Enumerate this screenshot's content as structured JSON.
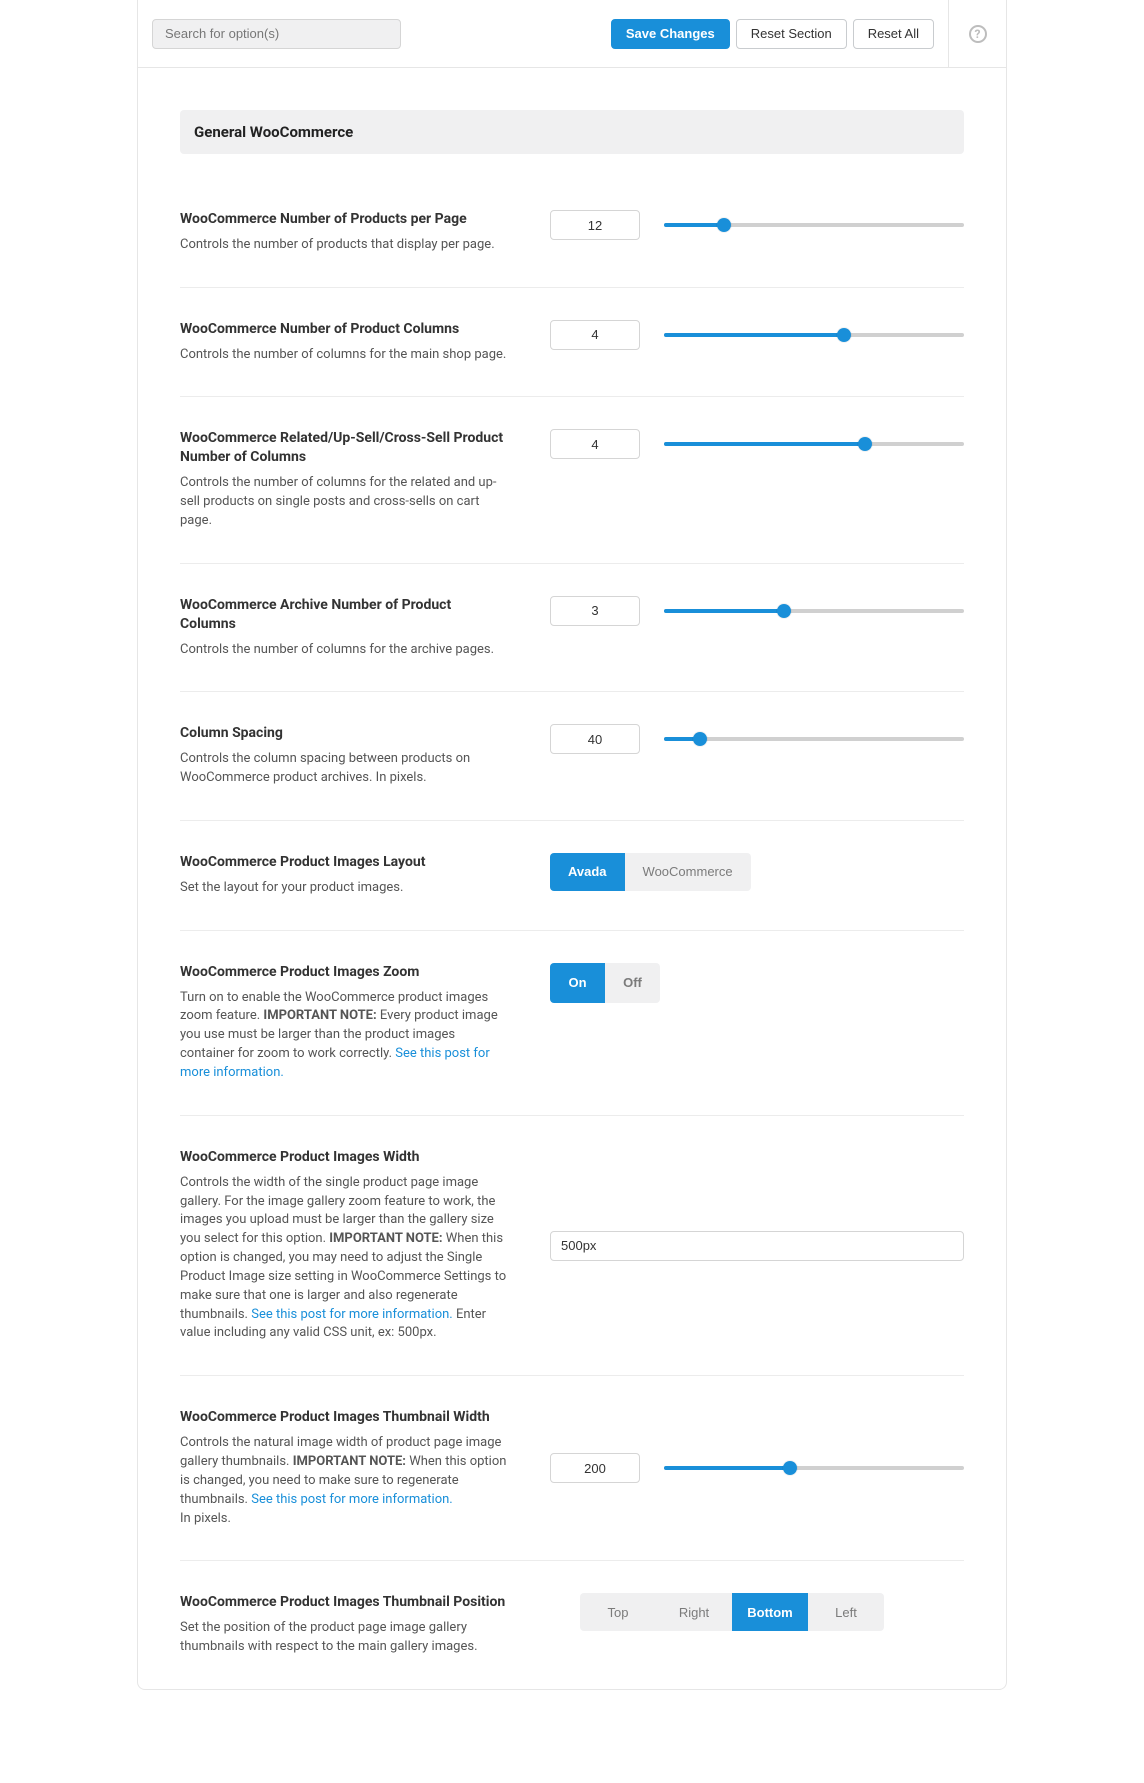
{
  "top": {
    "search_placeholder": "Search for option(s)",
    "save_label": "Save Changes",
    "reset_section_label": "Reset Section",
    "reset_all_label": "Reset All",
    "help_symbol": "?"
  },
  "section_title": "General WooCommerce",
  "common": {
    "link_text": "See this post for more information.",
    "important_note": "IMPORTANT NOTE:",
    "in_pixels": "In pixels."
  },
  "options": [
    {
      "key": "products_per_page",
      "title": "WooCommerce Number of Products per Page",
      "desc": "Controls the number of products that display per page.",
      "type": "slider",
      "value": "12",
      "percent": 20
    },
    {
      "key": "product_columns",
      "title": "WooCommerce Number of Product Columns",
      "desc": "Controls the number of columns for the main shop page.",
      "type": "slider",
      "value": "4",
      "percent": 60
    },
    {
      "key": "related_columns",
      "title": "WooCommerce Related/Up-Sell/Cross-Sell Product Number of Columns",
      "desc": "Controls the number of columns for the related and up-sell products on single posts and cross-sells on cart page.",
      "type": "slider",
      "value": "4",
      "percent": 67
    },
    {
      "key": "archive_columns",
      "title": "WooCommerce Archive Number of Product Columns",
      "desc": "Controls the number of columns for the archive pages.",
      "type": "slider",
      "value": "3",
      "percent": 40
    },
    {
      "key": "column_spacing",
      "title": "Column Spacing",
      "desc": "Controls the column spacing between products on WooCommerce product archives. In pixels.",
      "type": "slider",
      "value": "40",
      "percent": 12
    },
    {
      "key": "images_layout",
      "title": "WooCommerce Product Images Layout",
      "desc": "Set the layout for your product images.",
      "type": "buttons",
      "buttons": [
        "Avada",
        "WooCommerce"
      ],
      "active_index": 0
    },
    {
      "key": "images_zoom",
      "title": "WooCommerce Product Images Zoom",
      "desc_pre": "Turn on to enable the WooCommerce product images zoom feature. ",
      "desc_post": " Every product image you use must be larger than the product images container for zoom to work correctly. ",
      "type": "toggle",
      "on_label": "On",
      "off_label": "Off",
      "active": "on"
    },
    {
      "key": "images_width",
      "title": "WooCommerce Product Images Width",
      "desc_pre": "Controls the width of the single product page image gallery. For the image gallery zoom feature to work, the images you upload must be larger than the gallery size you select for this option. ",
      "desc_mid": " When this option is changed, you may need to adjust the Single Product Image size setting in WooCommerce Settings to make sure that one is larger and also regenerate thumbnails. ",
      "desc_post": " Enter value including any valid CSS unit, ex: 500px.",
      "type": "text",
      "value": "500px"
    },
    {
      "key": "thumb_width",
      "title": "WooCommerce Product Images Thumbnail Width",
      "desc_pre": "Controls the natural image width of product page image gallery thumbnails. ",
      "desc_post": " When this option is changed, you need to make sure to regenerate thumbnails. ",
      "type": "slider",
      "value": "200",
      "percent": 42
    },
    {
      "key": "thumb_position",
      "title": "WooCommerce Product Images Thumbnail Position",
      "desc": "Set the position of the product page image gallery thumbnails with respect to the main gallery images.",
      "type": "buttons4",
      "buttons": [
        "Top",
        "Right",
        "Bottom",
        "Left"
      ],
      "active_index": 2
    }
  ]
}
